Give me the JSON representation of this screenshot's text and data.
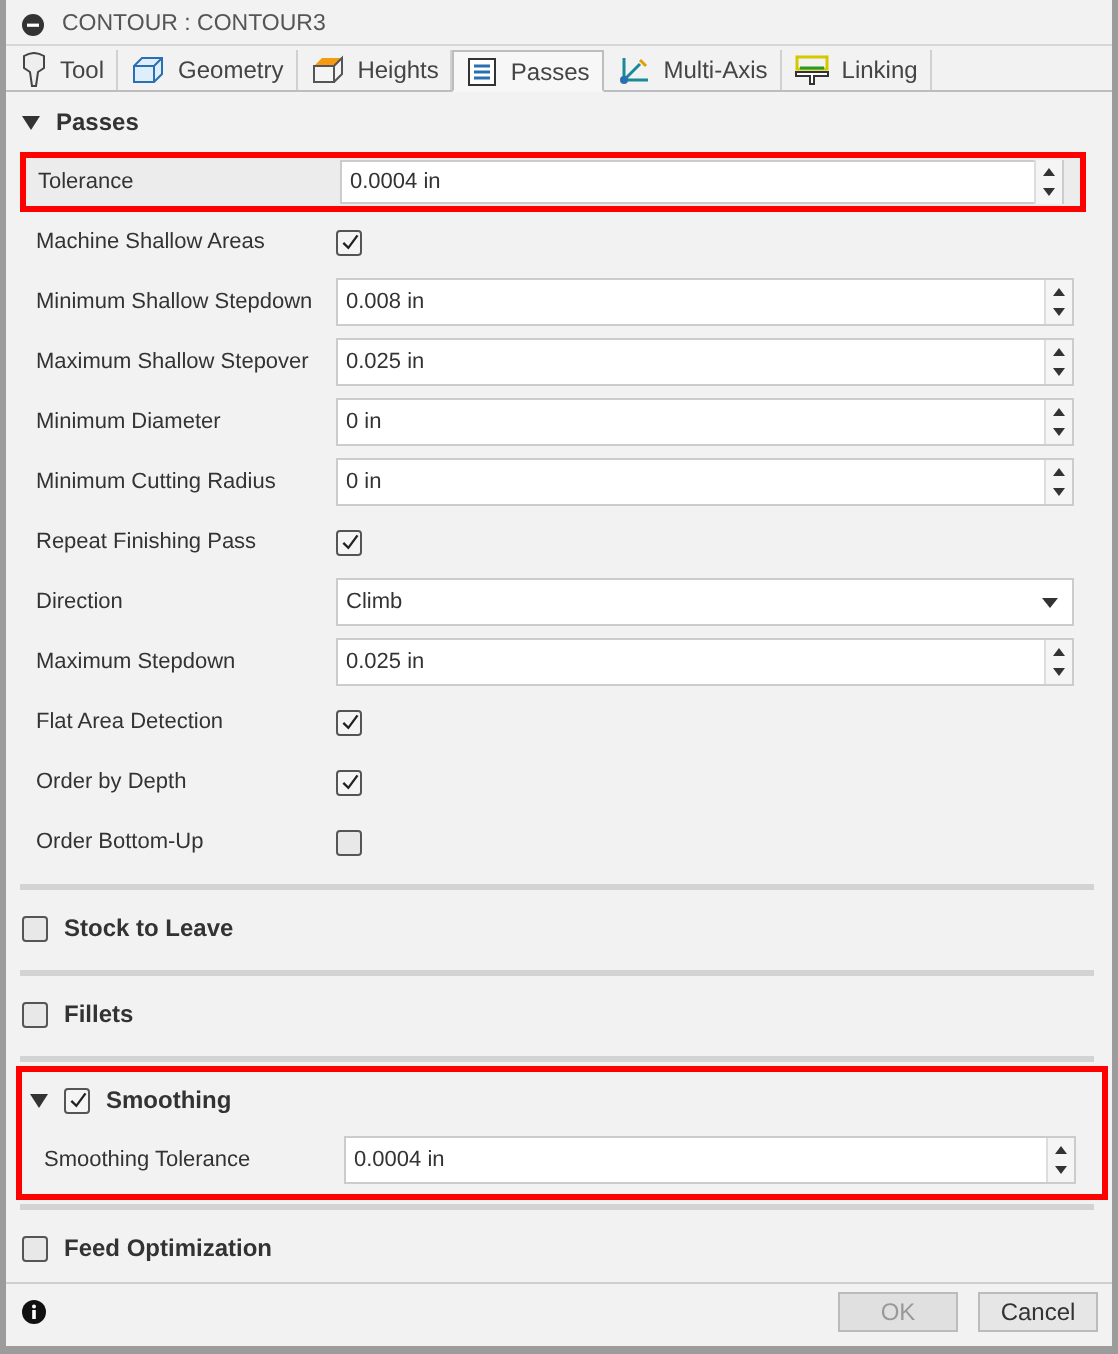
{
  "window": {
    "title": "CONTOUR : CONTOUR3"
  },
  "tabs": [
    {
      "label": "Tool",
      "selected": false
    },
    {
      "label": "Geometry",
      "selected": false
    },
    {
      "label": "Heights",
      "selected": false
    },
    {
      "label": "Passes",
      "selected": true
    },
    {
      "label": "Multi-Axis",
      "selected": false
    },
    {
      "label": "Linking",
      "selected": false
    }
  ],
  "sections": [
    {
      "title": "Passes",
      "expanded": true,
      "rows": [
        {
          "kind": "spinner",
          "label": "Tolerance",
          "value": "0.0004 in",
          "highlighted": true
        },
        {
          "kind": "checkbox",
          "label": "Machine Shallow Areas",
          "checked": true
        },
        {
          "kind": "spinner",
          "label": "Minimum Shallow Stepdown",
          "value": "0.008 in"
        },
        {
          "kind": "spinner",
          "label": "Maximum Shallow Stepover",
          "value": "0.025 in"
        },
        {
          "kind": "spinner",
          "label": "Minimum Diameter",
          "value": "0 in"
        },
        {
          "kind": "spinner",
          "label": "Minimum Cutting Radius",
          "value": "0 in"
        },
        {
          "kind": "checkbox",
          "label": "Repeat Finishing Pass",
          "checked": true
        },
        {
          "kind": "dropdown",
          "label": "Direction",
          "value": "Climb"
        },
        {
          "kind": "spinner",
          "label": "Maximum Stepdown",
          "value": "0.025 in"
        },
        {
          "kind": "checkbox",
          "label": "Flat Area Detection",
          "checked": true
        },
        {
          "kind": "checkbox",
          "label": "Order by Depth",
          "checked": true
        },
        {
          "kind": "checkbox",
          "label": "Order Bottom-Up",
          "checked": false
        }
      ]
    },
    {
      "title": "Stock to Leave",
      "expanded": false,
      "checked": false
    },
    {
      "title": "Fillets",
      "expanded": false,
      "checked": false
    },
    {
      "title": "Smoothing",
      "expanded": true,
      "checked": true,
      "highlighted": true,
      "rows": [
        {
          "kind": "spinner",
          "label": "Smoothing Tolerance",
          "value": "0.0004 in"
        }
      ]
    },
    {
      "title": "Feed Optimization",
      "expanded": false,
      "checked": false
    }
  ],
  "buttons": [
    {
      "label": "OK",
      "disabled": true
    },
    {
      "label": "Cancel",
      "disabled": false
    }
  ]
}
